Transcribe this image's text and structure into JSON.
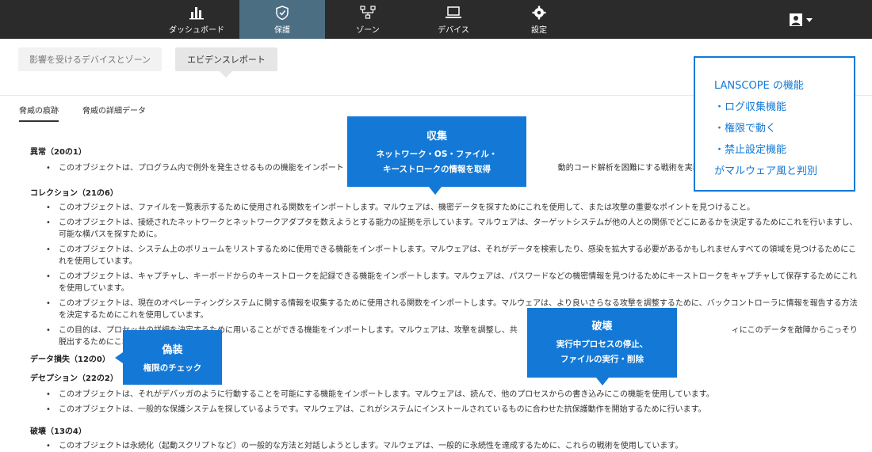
{
  "nav": {
    "items": [
      {
        "label": "ダッシュボード",
        "icon": "bar-chart-icon",
        "active": false
      },
      {
        "label": "保護",
        "icon": "shield-icon",
        "active": true
      },
      {
        "label": "ゾーン",
        "icon": "network-icon",
        "active": false
      },
      {
        "label": "デバイス",
        "icon": "laptop-icon",
        "active": false
      },
      {
        "label": "設定",
        "icon": "gear-icon",
        "active": false
      }
    ],
    "user_icon": "user-icon"
  },
  "subtabs": {
    "affected": "影響を受けるデバイスとゾーン",
    "evidence": "エビデンスレポート"
  },
  "threat_tabs": {
    "traces": "脅威の痕跡",
    "details": "脅威の詳細データ"
  },
  "sections": {
    "anomaly": {
      "title": "異常（20の1）",
      "items": [
        "このオブジェクトは、プログラム内で例外を発生させるものの機能をインポート　　　　　　　　　　　　　　　　　　　　　　　　　　　動的コード解析を困難にする戦術を実装する"
      ]
    },
    "collection": {
      "title": "コレクション（21の6）",
      "items": [
        "このオブジェクトは、ファイルを一覧表示するために使用される関数をインポートします。マルウェアは、機密データを探すためにこれを使用して、または攻撃の重要なポイントを見つけること。",
        "このオブジェクトは、接続されたネットワークとネットワークアダプタを数えようとする能力の証拠を示しています。マルウェアは、ターゲットシステムが他の人との関係でどこにあるかを決定するためにこれを行いますし、可能な横パスを探すために。",
        "このオブジェクトは、システム上のボリュームをリストするために使用できる機能をインポートします。マルウェアは、それがデータを検索したり、感染を拡大する必要があるかもしれませんすべての領域を見つけるためにこれを使用しています。",
        "このオブジェクトは、キャプチャし、キーボードからのキーストロークを記録できる機能をインポートします。マルウェアは、パスワードなどの機密情報を見つけるためにキーストロークをキャプチャして保存するためにこれを使用しています。",
        "このオブジェクトは、現在のオペレーティングシステムに関する情報を収集するために使用される関数をインポートします。マルウェアは、より良いさらなる攻撃を調整するために、バックコントローラに情報を報告する方法を決定するためにこれを使用しています。",
        "この目的は、プロセッサの詳細を決定するために用いることができる機能をインポートします。マルウェアは、攻撃を調整し、共　　　　　　　　　　　　　　　　　　　　　　　　　　　ィにこのデータを敵陣からこっそり脱出するためにこれを使用してい"
      ]
    },
    "data_loss": {
      "title": "データ損失（12の0）"
    },
    "deception": {
      "title": "デセプション（22の2）",
      "items": [
        "このオブジェクトは、それがデバッガのように行動することを可能にする機能をインポートします。マルウェアは、読んで、他のプロセスからの書き込みにこの機能を使用しています。",
        "このオブジェクトは、一般的な保護システムを探しているようです。マルウェアは、これがシステムにインストールされているものに合わせた抗保護動作を開始するために行います。"
      ]
    },
    "destruction": {
      "title": "破壊（13の4）",
      "items": [
        "このオブジェクトは永続化（起動スクリプトなど）の一般的な方法と対話しようとします。マルウェアは、一般的に永続性を達成するために、これらの戦術を使用しています。"
      ]
    }
  },
  "callouts": {
    "collect": {
      "title": "収集",
      "line1": "ネットワーク・OS・ファイル・",
      "line2": "キーストロークの情報を取得"
    },
    "destroy": {
      "title": "破壊",
      "line1": "実行中プロセスの停止、",
      "line2": "ファイルの実行・削除"
    },
    "fake": {
      "title": "偽装",
      "line1": "権限のチェック"
    }
  },
  "lanscope": {
    "line1": "LANSCOPE の機能",
    "line2": "・ログ収集機能",
    "line3": "・権限で動く",
    "line4": "・禁止設定機能",
    "line5": "がマルウェア風と判別"
  },
  "colors": {
    "nav_bg": "#2b2b2b",
    "nav_active": "#4c6e82",
    "callout": "#1479d6"
  }
}
